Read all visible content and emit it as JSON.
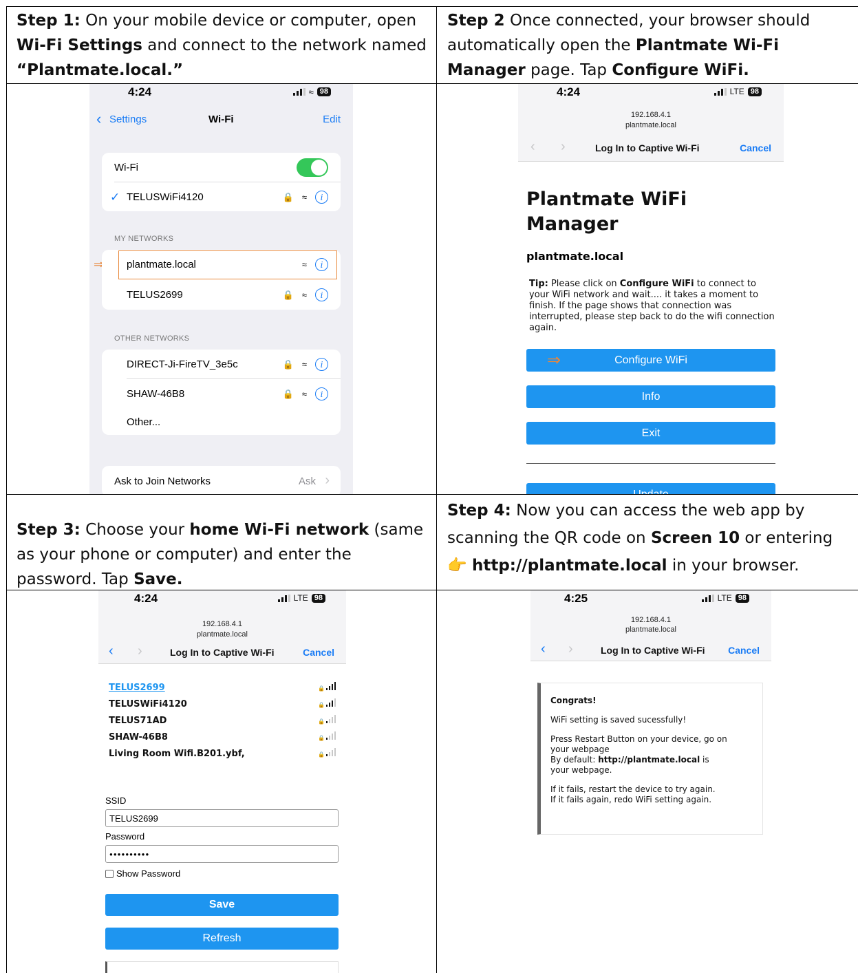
{
  "step1": {
    "label": "Step 1:",
    "t1": " On your mobile device or computer, open ",
    "b1": "Wi-Fi Settings",
    "t2": " and connect to the network named ",
    "b2": "“Plantmate.local.”"
  },
  "step2": {
    "label": "Step 2",
    "t1": " Once connected, your browser should automatically open the ",
    "b1": "Plantmate Wi-Fi Manager",
    "t2": " page. Tap ",
    "b2": "Configure WiFi."
  },
  "step3": {
    "label": "Step 3:",
    "t1": " Choose your ",
    "b1": "home Wi-Fi network",
    "t2": " (same as your phone or computer) and enter the password. Tap ",
    "b2": "Save."
  },
  "step4": {
    "label": "Step 4:",
    "t1": " Now you can access the web app by scanning the QR code on ",
    "b1": "Screen 10",
    "t2": " or entering ",
    "emoji": "👉",
    "b2": "http://plantmate.local",
    "t3": " in your browser."
  },
  "screen1": {
    "time": "4:24",
    "battery": "98",
    "back": "Settings",
    "title": "Wi-Fi",
    "edit": "Edit",
    "wifi_label": "Wi-Fi",
    "connected": "TELUSWiFi4120",
    "my_networks": "MY NETWORKS",
    "my": [
      "plantmate.local",
      "TELUS2699"
    ],
    "other_networks": "OTHER NETWORKS",
    "other": [
      "DIRECT-Ji-FireTV_3e5c",
      "SHAW-46B8",
      "Other..."
    ],
    "ask_label": "Ask to Join Networks",
    "ask_value": "Ask"
  },
  "screen2": {
    "time": "4:24",
    "network": "LTE",
    "battery": "98",
    "ip": "192.168.4.1",
    "host": "plantmate.local",
    "nav_title": "Log In to Captive Wi-Fi",
    "cancel": "Cancel",
    "heading_line1": "Plantmate WiFi",
    "heading_line2": "Manager",
    "subheading": "plantmate.local",
    "tip_label": "Tip:",
    "tip_t1": " Please click on ",
    "tip_b1": "Configure WiFi",
    "tip_t2": " to connect to your WiFi network and wait.... it takes a moment to finish. If the page shows that connection was interrupted, please step back to do the wifi connection again.",
    "btn_configure": "Configure WiFi",
    "btn_info": "Info",
    "btn_exit": "Exit",
    "btn_update": "Update"
  },
  "screen3": {
    "time": "4:24",
    "network": "LTE",
    "battery": "98",
    "ip": "192.168.4.1",
    "host": "plantmate.local",
    "nav_title": "Log In to Captive Wi-Fi",
    "cancel": "Cancel",
    "networks": [
      {
        "name": "TELUS2699",
        "bars": 4
      },
      {
        "name": "TELUSWiFi4120",
        "bars": 3
      },
      {
        "name": "TELUS71AD",
        "bars": 1
      },
      {
        "name": "SHAW-46B8",
        "bars": 1
      },
      {
        "name": "Living Room Wifi.B201.ybf,",
        "bars": 1
      }
    ],
    "ssid_label": "SSID",
    "ssid_value": "TELUS2699",
    "password_label": "Password",
    "password_value": "●●●●●●●●●●",
    "show_password": "Show Password",
    "btn_save": "Save",
    "btn_refresh": "Refresh"
  },
  "screen4": {
    "time": "4:25",
    "network": "LTE",
    "battery": "98",
    "ip": "192.168.4.1",
    "host": "plantmate.local",
    "nav_title": "Log In to Captive Wi-Fi",
    "cancel": "Cancel",
    "congrats": "Congrats!",
    "saved": "WiFi setting is saved sucessfully!",
    "restart_line1": "Press Restart Button on your device, go on",
    "restart_line2": "your webpage",
    "default_t": "By default: ",
    "default_b": "http://plantmate.local",
    "default_t2": " is",
    "default_line2": "your webpage.",
    "fail1": "If it fails, restart the device to try again.",
    "fail2": "If it fails again, redo WiFi setting again."
  },
  "colors": {
    "ios_blue": "#1a7cf5",
    "button_blue": "#1e95f0",
    "toggle_green": "#34c759",
    "highlight_orange": "#e8873a"
  }
}
